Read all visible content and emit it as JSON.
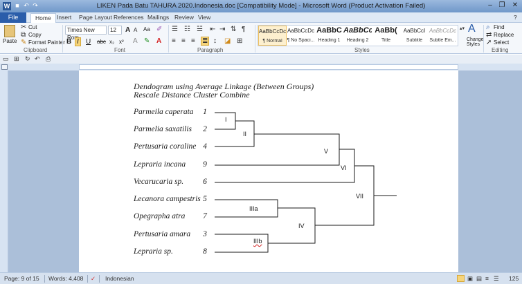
{
  "window": {
    "title": "LIKEN Pada Batu TAHURA 2020.Indonesia.doc [Compatibility Mode] - Microsoft Word (Product Activation Failed)",
    "app_icon": "W"
  },
  "ribbon_tabs": [
    "File",
    "Home",
    "Insert",
    "Page Layout",
    "References",
    "Mailings",
    "Review",
    "View"
  ],
  "clipboard": {
    "paste": "Paste",
    "cut": "Cut",
    "copy": "Copy",
    "format_painter": "Format Painter",
    "label": "Clipboard"
  },
  "font": {
    "name": "Times New Rom",
    "size": "12",
    "bold": "B",
    "italic": "I",
    "underline": "U",
    "strike": "abc",
    "subscript": "x₂",
    "superscript": "x²",
    "grow": "A",
    "shrink": "A",
    "change_case": "Aa",
    "label": "Font"
  },
  "paragraph": {
    "label": "Paragraph"
  },
  "styles": {
    "label": "Styles",
    "items": [
      {
        "sample": "AaBbCcDc",
        "name": "¶ Normal",
        "selected": true
      },
      {
        "sample": "AaBbCcDc",
        "name": "¶ No Spaci...",
        "selected": false
      },
      {
        "sample": "AaBbC",
        "name": "Heading 1",
        "selected": false
      },
      {
        "sample": "AaBbCc",
        "name": "Heading 2",
        "selected": false
      },
      {
        "sample": "AaBb(",
        "name": "Title",
        "selected": false
      },
      {
        "sample": "AaBbCcI",
        "name": "Subtitle",
        "selected": false
      },
      {
        "sample": "AaBbCcDc",
        "name": "Subtle Em...",
        "selected": false
      }
    ],
    "change_styles": "Change Styles"
  },
  "editing": {
    "label": "Editing",
    "find": "Find",
    "replace": "Replace",
    "select": "Select"
  },
  "document": {
    "heading_line1": "Dendogram using Average Linkage (Between Groups)",
    "heading_line2": "Rescale Distance Cluster Combine",
    "species": [
      {
        "name": "Parmeila caperata",
        "number": "1"
      },
      {
        "name": "Parmelia saxatilis",
        "number": "2"
      },
      {
        "name": "Pertusaria coraline",
        "number": "4"
      },
      {
        "name": "Lepraria incana",
        "number": "9"
      },
      {
        "name": "Vecarucaria sp.",
        "number": "6"
      },
      {
        "name": "Lecanora campestris",
        "number": "5"
      },
      {
        "name": "Opegrapha atra",
        "number": "7"
      },
      {
        "name": "Pertusaria amara",
        "number": "3"
      },
      {
        "name": "Lepraria sp.",
        "number": "8"
      }
    ],
    "cluster_labels": {
      "I": "I",
      "II": "II",
      "V": "V",
      "VI": "VI",
      "VII": "VII",
      "IIIa": "IIIa",
      "IV": "IV",
      "IIIb": "IIIb"
    }
  },
  "status": {
    "page": "Page: 9 of 15",
    "words": "Words: 4,408",
    "language": "Indonesian",
    "zoom": "125"
  },
  "colors": {
    "file_tab": "#2a5daa",
    "title_bar": "#7da2ce",
    "selected_style": "#fdf0cf"
  }
}
